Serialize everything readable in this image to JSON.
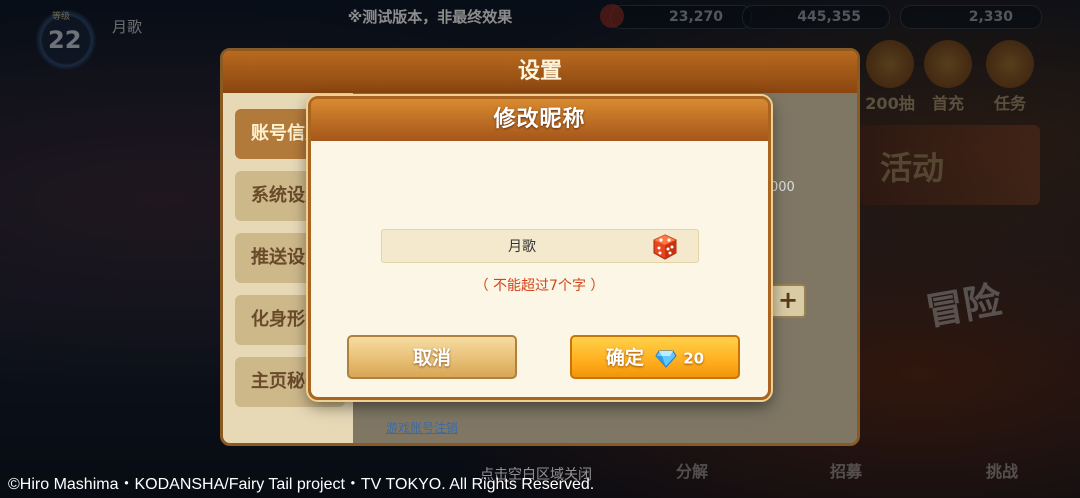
{
  "notice": "※测试版本，非最终效果",
  "player": {
    "level_tag": "等级",
    "level": "22",
    "name": "月歌"
  },
  "resources": [
    {
      "value": "23,270"
    },
    {
      "value": "445,355"
    },
    {
      "value": "2,330"
    }
  ],
  "right_menu": [
    {
      "label": "200抽"
    },
    {
      "label": "首充"
    },
    {
      "label": "任务"
    }
  ],
  "banner_text": "活动",
  "adventure_text": "冒险",
  "settings": {
    "title": "设置",
    "tabs": [
      "账号信息",
      "系统设置",
      "推送设置",
      "化身形象",
      "主页秘书"
    ],
    "account_cancel": "游戏账号注销",
    "slider_value": "000",
    "plus": "+",
    "close_hint": "点击空白区域关闭"
  },
  "bottom_nav": [
    "分解",
    "招募",
    "挑战"
  ],
  "dialog": {
    "title": "修改昵称",
    "name_value": "月歌",
    "hint": "（ 不能超过7个字 ）",
    "cancel_label": "取消",
    "confirm_label": "确定",
    "confirm_cost": "20",
    "colors": {
      "header": "#b86a1e",
      "confirm": "#ffae1e",
      "hint": "#d4451a"
    }
  },
  "copyright": "©Hiro Mashima・KODANSHA/Fairy Tail project・TV TOKYO. All Rights Reserved."
}
